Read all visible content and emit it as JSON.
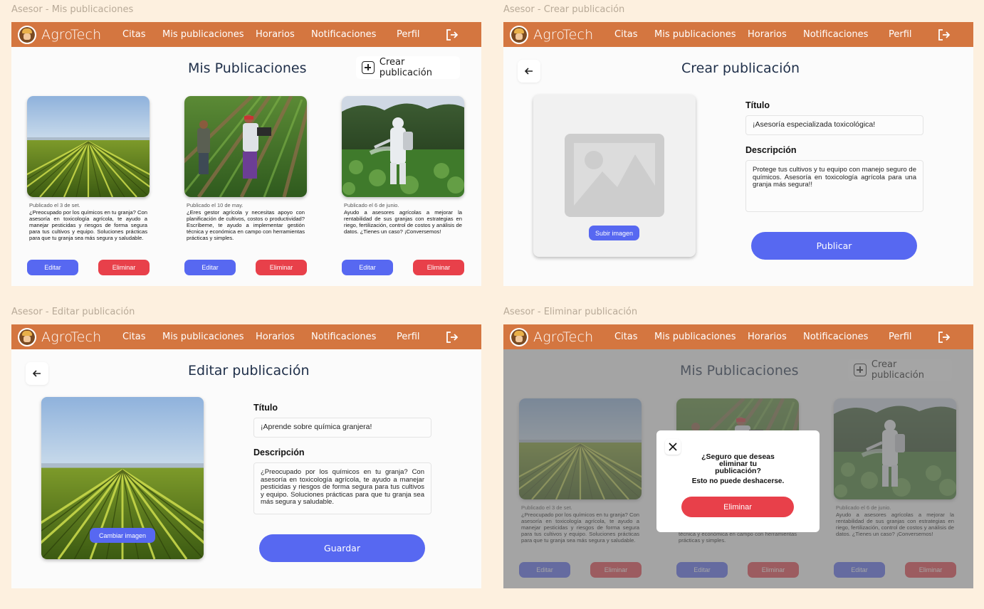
{
  "frames": {
    "mis_publicaciones": "Asesor - Mis publicaciones",
    "crear": "Asesor - Crear publicación",
    "editar": "Asesor - Editar publicación",
    "eliminar": "Asesor - Eliminar publicación"
  },
  "nav": {
    "brand": "AgroTech",
    "citas": "Citas",
    "publicaciones": "Mis publicaciones",
    "horarios": "Horarios",
    "notificaciones": "Notificaciones",
    "perfil": "Perfil",
    "logout_icon": "logout-icon"
  },
  "list_page": {
    "title": "Mis Publicaciones",
    "create_button": "Crear publicación",
    "posts": [
      {
        "date": "Publicado el 3 de set.",
        "text": "¿Preocupado por los químicos en tu granja? Con asesoría en toxicología agrícola, te ayudo a manejar pesticidas y riesgos de forma segura para tus cultivos y equipo. Soluciones prácticas para que tu granja sea más segura y saludable.",
        "edit": "Editar",
        "delete": "Eliminar"
      },
      {
        "date": "Publicado el 10 de may.",
        "text": "¿Eres gestor agrícola y necesitas apoyo con planificación de cultivos, costos o productividad? Escríbeme, te ayudo a implementar gestión técnica y económica en campo con herramientas prácticas y simples.",
        "edit": "Editar",
        "delete": "Eliminar"
      },
      {
        "date": "Publicado el 6 de junio.",
        "text": "Ayudo a asesores agrícolas a mejorar la rentabilidad de sus granjas con estrategias en riego, fertilización, control de costos y análisis de datos. ¿Tienes un caso? ¡Conversemos!",
        "edit": "Editar",
        "delete": "Eliminar"
      }
    ]
  },
  "create_page": {
    "title": "Crear publicación",
    "upload_button": "Subir imagen",
    "title_label": "Título",
    "title_value": "¡Asesoría especializada toxicológica!",
    "description_label": "Descripción",
    "description_value": "Protege tus cultivos y tu equipo con manejo seguro de químicos. Asesoría en toxicología agrícola para una granja más segura!!",
    "submit": "Publicar"
  },
  "edit_page": {
    "title": "Editar publicación",
    "change_image": "Cambiar imagen",
    "title_label": "Título",
    "title_value": "¡Aprende sobre química granjera!",
    "description_label": "Descripción",
    "description_value": "¿Preocupado por los químicos en tu granja? Con asesoría en toxicología agrícola, te ayudo a manejar pesticidas y riesgos de forma segura para tus cultivos y equipo. Soluciones prácticas para que tu granja sea más segura y saludable.",
    "submit": "Guardar"
  },
  "delete_modal": {
    "question": "¿Seguro que deseas eliminar tu publicación?",
    "warning": "Esto no puede deshacerse.",
    "confirm": "Eliminar"
  },
  "colors": {
    "navbar": "#d47640",
    "primary": "#5768f1",
    "danger": "#e8404a",
    "background": "#fdf0df"
  }
}
